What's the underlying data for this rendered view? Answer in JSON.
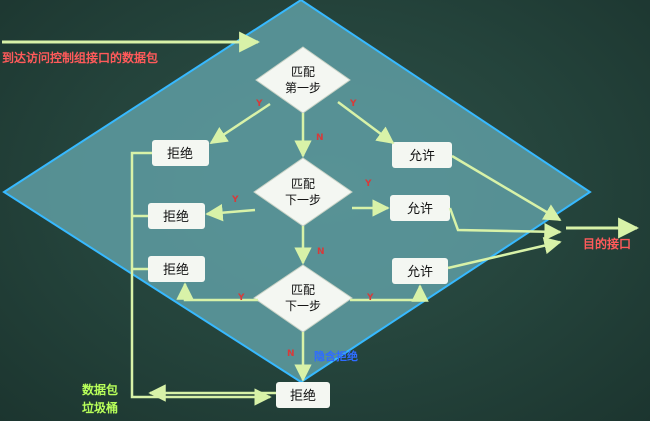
{
  "labels": {
    "arrival": "到达访问控制组接口的数据包",
    "destination": "目的接口",
    "implicit_deny": "隐含拒绝",
    "garbage_line1": "数据包",
    "garbage_line2": "垃圾桶"
  },
  "match_steps": [
    {
      "line1": "匹配",
      "line2": "第一步"
    },
    {
      "line1": "匹配",
      "line2": "下一步"
    },
    {
      "line1": "匹配",
      "line2": "下一步"
    }
  ],
  "deny_label": "拒绝",
  "permit_label": "允许",
  "yes_mark": "Y",
  "no_mark": "N",
  "colors": {
    "background": "#24413a",
    "big_diamond_fill": "#5f9ea3",
    "big_diamond_stroke": "#37b9ff",
    "arrow": "#d8f2a8",
    "red": "#ff5a5a",
    "green": "#b8ff5a",
    "blue": "#2f6cff"
  }
}
